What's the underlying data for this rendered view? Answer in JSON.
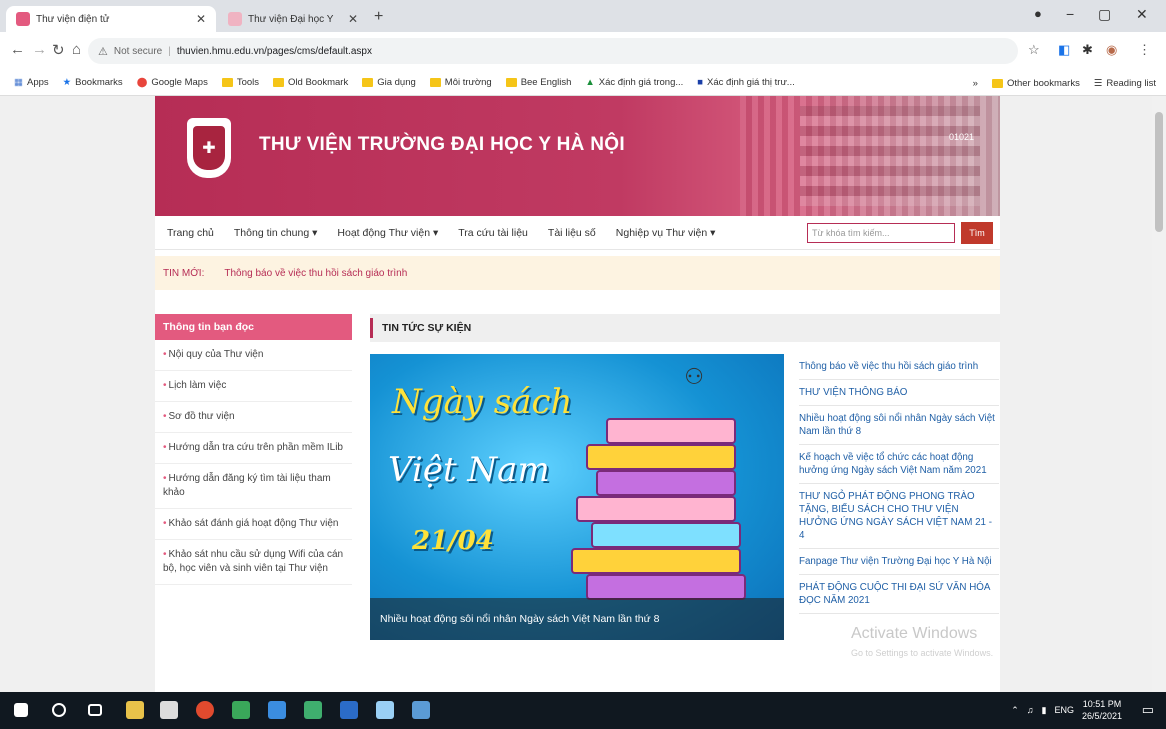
{
  "browser": {
    "tabs": [
      {
        "title": "Thư viện điện tử",
        "active": true
      },
      {
        "title": "Thư viện Đại học Y",
        "active": false
      }
    ],
    "new_tab": "+",
    "window_controls": {
      "minimize": "−",
      "maximize": "▢",
      "close": "✕"
    },
    "address": {
      "security": "Not secure",
      "url": "thuvien.hmu.edu.vn/pages/cms/default.aspx"
    },
    "bookmarks": [
      "Apps",
      "Bookmarks",
      "Google Maps",
      "Tools",
      "Old Bookmark",
      "Gia dụng",
      "Môi trường",
      "Bee English",
      "Xác định giá trong...",
      "Xác định giá thị trư..."
    ],
    "bookmarks_right": [
      "Other bookmarks",
      "Reading list"
    ]
  },
  "site": {
    "title": "THƯ VIỆN TRƯỜNG ĐẠI HỌC Y HÀ NỘI",
    "header_code": "01021",
    "nav": [
      "Trang chủ",
      "Thông tin chung ▾",
      "Hoạt động Thư viện ▾",
      "Tra cứu tài liệu",
      "Tài liệu số",
      "Nghiệp vụ Thư viện ▾"
    ],
    "search_placeholder": "Từ khóa tìm kiếm...",
    "search_button": "Tìm",
    "news_label": "TIN MỚI:",
    "news_ticker": "Thông báo về việc thu hồi sách giáo trình"
  },
  "sidebar": {
    "heading": "Thông tin bạn đọc",
    "items": [
      "Nội quy của Thư viện",
      "Lịch làm việc",
      "Sơ đồ thư viện",
      "Hướng dẫn tra cứu trên phần mềm ILib",
      "Hướng dẫn đăng ký tìm tài liệu tham khảo",
      "Khảo sát đánh giá hoạt động Thư viện",
      "Khảo sát nhu cầu sử dụng Wifi của cán bộ, học viên và sinh viên tại Thư viện"
    ]
  },
  "content": {
    "heading": "TIN TỨC SỰ KIỆN",
    "feature": {
      "line1": "Ngày sách",
      "line2": "Việt Nam",
      "date": "21/04",
      "caption": "Nhiều hoạt động sôi nổi nhân Ngày sách Việt Nam lần thứ 8"
    },
    "news": [
      "Thông báo về việc thu hồi sách giáo trình",
      "THƯ VIỆN THÔNG BÁO",
      "Nhiều hoạt động sôi nổi nhân Ngày sách Việt Nam lần thứ 8",
      "Kế hoạch về việc tổ chức các hoạt động hưởng ứng Ngày sách Việt Nam năm 2021",
      "THƯ NGỎ PHÁT ĐỘNG PHONG TRÀO TẶNG, BIẾU SÁCH CHO THƯ VIỆN HƯỞNG ỨNG NGÀY SÁCH VIỆT NAM 21 - 4",
      "Fanpage Thư viện Trường Đại học Y Hà Nội",
      "PHÁT ĐỘNG CUỘC THI ĐẠI SỨ VĂN HÓA ĐỌC NĂM 2021"
    ]
  },
  "watermark": {
    "line1": "Activate Windows",
    "line2": "Go to Settings to activate Windows."
  },
  "taskbar": {
    "lang": "ENG",
    "time": "10:51 PM",
    "date": "26/5/2021"
  }
}
